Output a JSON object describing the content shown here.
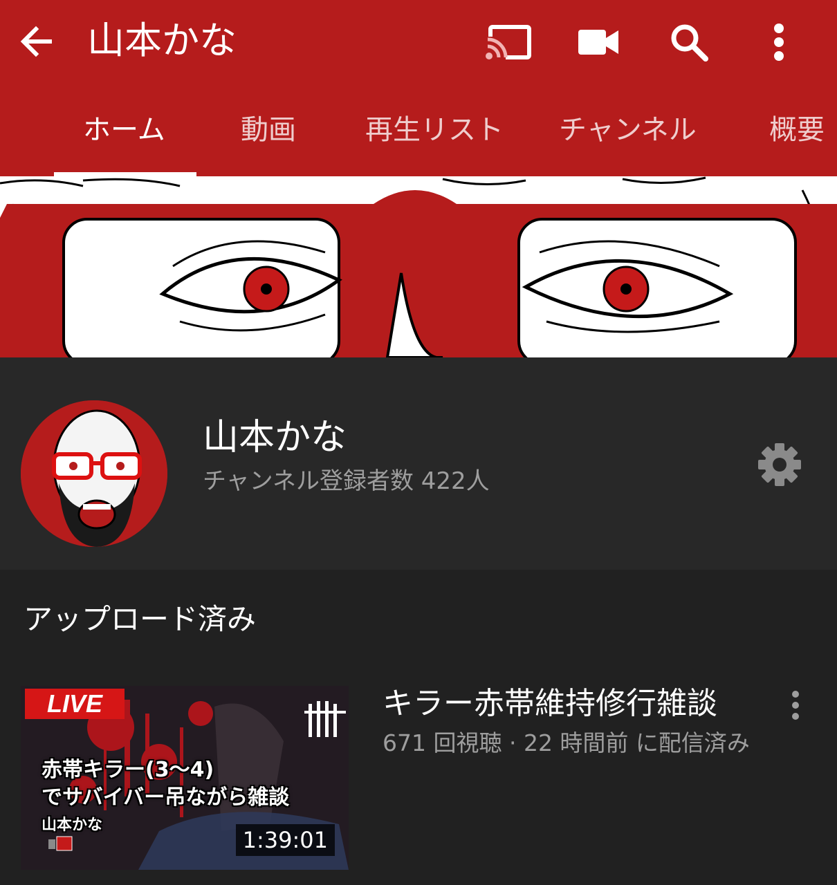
{
  "header": {
    "channel_title": "山本かな",
    "icons": [
      "back-arrow-icon",
      "cast-icon",
      "video-camera-icon",
      "search-icon",
      "more-vert-icon"
    ],
    "color": "#b51c1c"
  },
  "tabs": [
    {
      "label": "ホーム",
      "selected": true
    },
    {
      "label": "動画"
    },
    {
      "label": "再生リスト"
    },
    {
      "label": "チャンネル"
    },
    {
      "label": "概要"
    }
  ],
  "channel": {
    "name": "山本かな",
    "subscribers": "チャンネル登録者数 422人"
  },
  "uploads": {
    "section_title": "アップロード済み",
    "videos": [
      {
        "live_badge": "LIVE",
        "thumb_line1": "赤帯キラー(3〜4)",
        "thumb_line2": "でサバイバー吊ながら雑談",
        "thumb_line3": "山本かな",
        "duration": "1:39:01",
        "title": "キラー赤帯維持修行雑談",
        "meta": "671 回視聴 · 22 時間前 に配信済み"
      }
    ]
  }
}
